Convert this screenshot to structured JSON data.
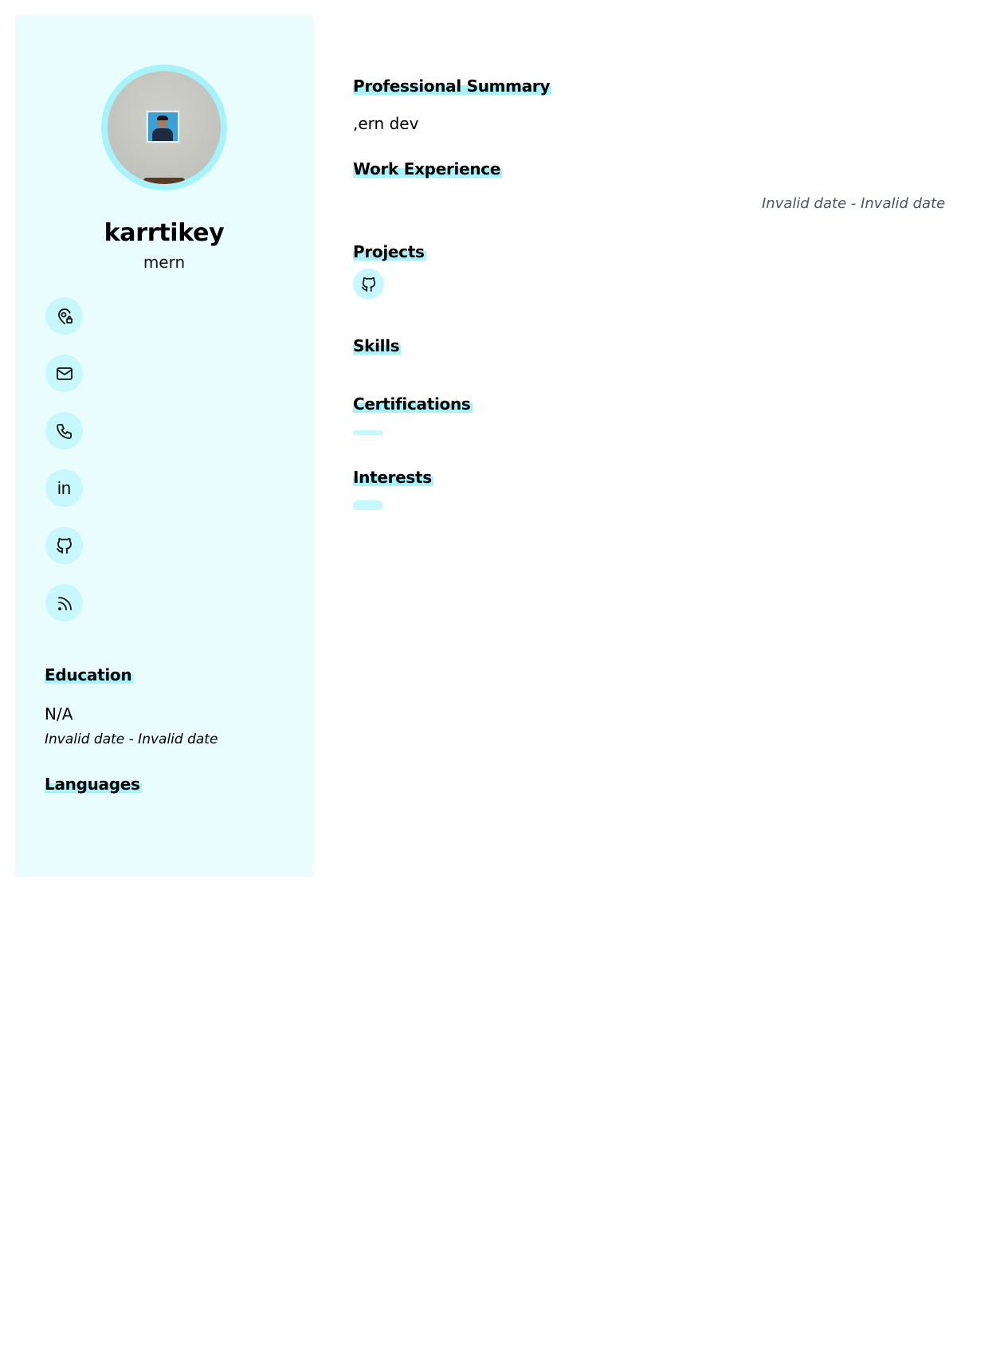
{
  "profile": {
    "name": "karrtikey",
    "role": "mern"
  },
  "contacts": [
    {
      "icon": "location-pin-icon"
    },
    {
      "icon": "mail-icon"
    },
    {
      "icon": "phone-icon"
    },
    {
      "icon": "linkedin-icon",
      "glyph": "in"
    },
    {
      "icon": "github-icon"
    },
    {
      "icon": "rss-icon"
    }
  ],
  "sidebar": {
    "education_heading": "Education",
    "education": {
      "school": "N/A",
      "dates": "Invalid date - Invalid date"
    },
    "languages_heading": "Languages"
  },
  "main": {
    "summary_heading": "Professional Summary",
    "summary_text": ",ern dev",
    "work_heading": "Work Experience",
    "work_dates": "Invalid date - Invalid date",
    "projects_heading": "Projects",
    "project_icon": "github-icon",
    "skills_heading": "Skills",
    "certifications_heading": "Certifications",
    "interests_heading": "Interests"
  },
  "colors": {
    "sidebar_bg": "#e9fdfe",
    "accent": "#a6f3fb",
    "icon_bg": "#c7f8fd",
    "date_gray": "#4b5563"
  }
}
